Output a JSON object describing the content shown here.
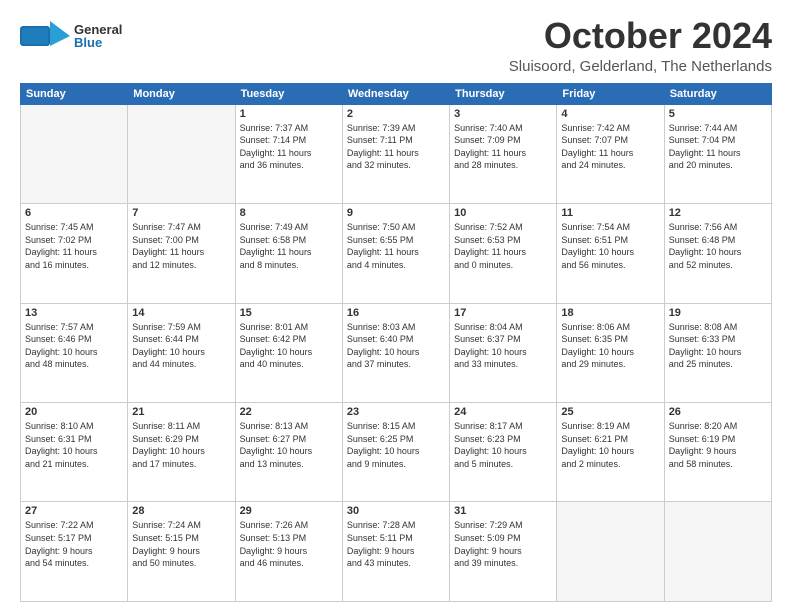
{
  "header": {
    "logo_general": "General",
    "logo_blue": "Blue",
    "month_title": "October 2024",
    "location": "Sluisoord, Gelderland, The Netherlands"
  },
  "days_header": [
    "Sunday",
    "Monday",
    "Tuesday",
    "Wednesday",
    "Thursday",
    "Friday",
    "Saturday"
  ],
  "weeks": [
    [
      {
        "day": "",
        "text": ""
      },
      {
        "day": "",
        "text": ""
      },
      {
        "day": "1",
        "text": "Sunrise: 7:37 AM\nSunset: 7:14 PM\nDaylight: 11 hours\nand 36 minutes."
      },
      {
        "day": "2",
        "text": "Sunrise: 7:39 AM\nSunset: 7:11 PM\nDaylight: 11 hours\nand 32 minutes."
      },
      {
        "day": "3",
        "text": "Sunrise: 7:40 AM\nSunset: 7:09 PM\nDaylight: 11 hours\nand 28 minutes."
      },
      {
        "day": "4",
        "text": "Sunrise: 7:42 AM\nSunset: 7:07 PM\nDaylight: 11 hours\nand 24 minutes."
      },
      {
        "day": "5",
        "text": "Sunrise: 7:44 AM\nSunset: 7:04 PM\nDaylight: 11 hours\nand 20 minutes."
      }
    ],
    [
      {
        "day": "6",
        "text": "Sunrise: 7:45 AM\nSunset: 7:02 PM\nDaylight: 11 hours\nand 16 minutes."
      },
      {
        "day": "7",
        "text": "Sunrise: 7:47 AM\nSunset: 7:00 PM\nDaylight: 11 hours\nand 12 minutes."
      },
      {
        "day": "8",
        "text": "Sunrise: 7:49 AM\nSunset: 6:58 PM\nDaylight: 11 hours\nand 8 minutes."
      },
      {
        "day": "9",
        "text": "Sunrise: 7:50 AM\nSunset: 6:55 PM\nDaylight: 11 hours\nand 4 minutes."
      },
      {
        "day": "10",
        "text": "Sunrise: 7:52 AM\nSunset: 6:53 PM\nDaylight: 11 hours\nand 0 minutes."
      },
      {
        "day": "11",
        "text": "Sunrise: 7:54 AM\nSunset: 6:51 PM\nDaylight: 10 hours\nand 56 minutes."
      },
      {
        "day": "12",
        "text": "Sunrise: 7:56 AM\nSunset: 6:48 PM\nDaylight: 10 hours\nand 52 minutes."
      }
    ],
    [
      {
        "day": "13",
        "text": "Sunrise: 7:57 AM\nSunset: 6:46 PM\nDaylight: 10 hours\nand 48 minutes."
      },
      {
        "day": "14",
        "text": "Sunrise: 7:59 AM\nSunset: 6:44 PM\nDaylight: 10 hours\nand 44 minutes."
      },
      {
        "day": "15",
        "text": "Sunrise: 8:01 AM\nSunset: 6:42 PM\nDaylight: 10 hours\nand 40 minutes."
      },
      {
        "day": "16",
        "text": "Sunrise: 8:03 AM\nSunset: 6:40 PM\nDaylight: 10 hours\nand 37 minutes."
      },
      {
        "day": "17",
        "text": "Sunrise: 8:04 AM\nSunset: 6:37 PM\nDaylight: 10 hours\nand 33 minutes."
      },
      {
        "day": "18",
        "text": "Sunrise: 8:06 AM\nSunset: 6:35 PM\nDaylight: 10 hours\nand 29 minutes."
      },
      {
        "day": "19",
        "text": "Sunrise: 8:08 AM\nSunset: 6:33 PM\nDaylight: 10 hours\nand 25 minutes."
      }
    ],
    [
      {
        "day": "20",
        "text": "Sunrise: 8:10 AM\nSunset: 6:31 PM\nDaylight: 10 hours\nand 21 minutes."
      },
      {
        "day": "21",
        "text": "Sunrise: 8:11 AM\nSunset: 6:29 PM\nDaylight: 10 hours\nand 17 minutes."
      },
      {
        "day": "22",
        "text": "Sunrise: 8:13 AM\nSunset: 6:27 PM\nDaylight: 10 hours\nand 13 minutes."
      },
      {
        "day": "23",
        "text": "Sunrise: 8:15 AM\nSunset: 6:25 PM\nDaylight: 10 hours\nand 9 minutes."
      },
      {
        "day": "24",
        "text": "Sunrise: 8:17 AM\nSunset: 6:23 PM\nDaylight: 10 hours\nand 5 minutes."
      },
      {
        "day": "25",
        "text": "Sunrise: 8:19 AM\nSunset: 6:21 PM\nDaylight: 10 hours\nand 2 minutes."
      },
      {
        "day": "26",
        "text": "Sunrise: 8:20 AM\nSunset: 6:19 PM\nDaylight: 9 hours\nand 58 minutes."
      }
    ],
    [
      {
        "day": "27",
        "text": "Sunrise: 7:22 AM\nSunset: 5:17 PM\nDaylight: 9 hours\nand 54 minutes."
      },
      {
        "day": "28",
        "text": "Sunrise: 7:24 AM\nSunset: 5:15 PM\nDaylight: 9 hours\nand 50 minutes."
      },
      {
        "day": "29",
        "text": "Sunrise: 7:26 AM\nSunset: 5:13 PM\nDaylight: 9 hours\nand 46 minutes."
      },
      {
        "day": "30",
        "text": "Sunrise: 7:28 AM\nSunset: 5:11 PM\nDaylight: 9 hours\nand 43 minutes."
      },
      {
        "day": "31",
        "text": "Sunrise: 7:29 AM\nSunset: 5:09 PM\nDaylight: 9 hours\nand 39 minutes."
      },
      {
        "day": "",
        "text": ""
      },
      {
        "day": "",
        "text": ""
      }
    ]
  ]
}
